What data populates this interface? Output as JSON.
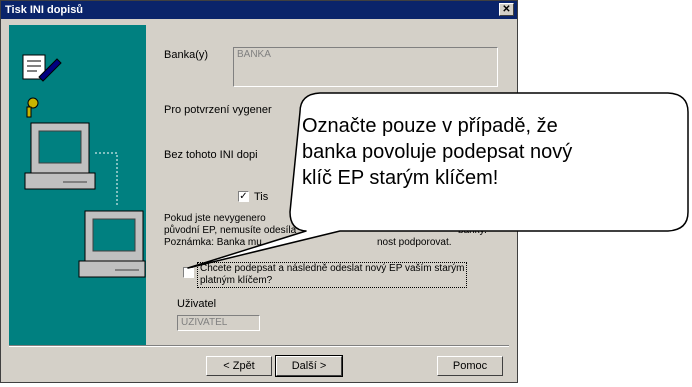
{
  "window": {
    "title": "Tisk INI dopisů",
    "close_glyph": "✕"
  },
  "bank": {
    "label": "Banka(y)",
    "value": "BANKA"
  },
  "info": {
    "line1": "Pro potvrzení vygener",
    "line2": "Bez tohoto INI dopi",
    "print_checkbox_label": "Tis",
    "print_checked": true,
    "note_a": "Pokud jste nevygenero",
    "note_b": "banky.",
    "note_c": "původní EP, nemusíte odesíla",
    "note_d": "Poznámka: Banka mu",
    "note_e": "nost podporovat."
  },
  "sign_checkbox": {
    "label_line1": "Chcete podepsat a následně odeslat nový EP vaším starým",
    "label_line2": "platným klíčem?",
    "checked": false
  },
  "user": {
    "label": "Uživatel",
    "value": "UZIVATEL"
  },
  "buttons": {
    "back": "< Zpět",
    "next": "Další >",
    "help": "Pomoc"
  },
  "callout": {
    "line1": "Označte pouze v případě, že",
    "line2": "banka povoluje podepsat nový",
    "line3": "klíč EP starým klíčem!"
  },
  "colors": {
    "title_bar": "#0a246a",
    "art_bg": "#008080",
    "dialog_bg": "#d4d0c8"
  }
}
